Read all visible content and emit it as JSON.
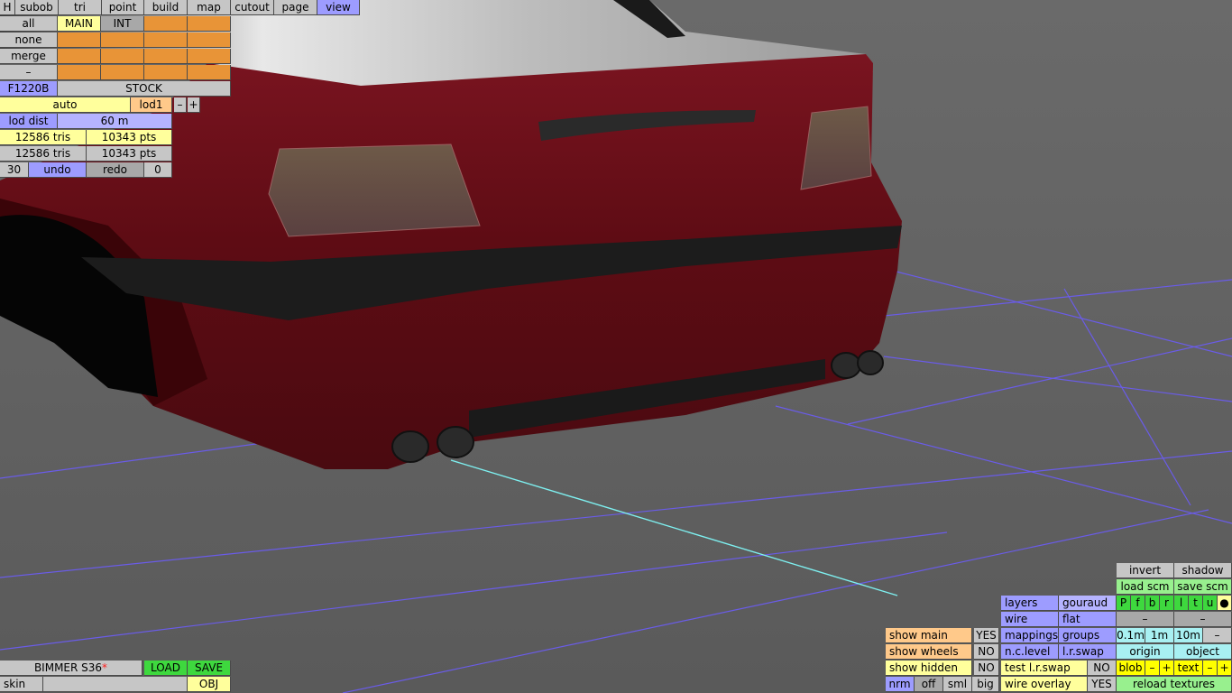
{
  "top_menu": [
    "H",
    "subob",
    "tri",
    "point",
    "build",
    "map",
    "cutout",
    "page",
    "view"
  ],
  "selection": {
    "rows": [
      "all",
      "none",
      "merge",
      "–"
    ],
    "main_label": "MAIN",
    "int_label": "INT"
  },
  "object": {
    "code": "F1220B",
    "variant": "STOCK",
    "lod_mode": "auto",
    "lod_level": "lod1",
    "minus": "–",
    "plus": "+",
    "lod_dist_label": "lod dist",
    "lod_dist_value": "60 m",
    "tris1": "12586 tris",
    "pts1": "10343 pts",
    "tris2": "12586 tris",
    "pts2": "10343 pts",
    "undo_count": "30",
    "undo_label": "undo",
    "redo_label": "redo",
    "redo_count": "0"
  },
  "file": {
    "name": "BIMMER S36",
    "modified_mark": "*",
    "load": "LOAD",
    "save": "SAVE",
    "skin": "skin",
    "obj": "OBJ"
  },
  "view_panel": {
    "invert": "invert",
    "shadow": "shadow",
    "load_scm": "load scm",
    "save_scm": "save scm",
    "layer_flags": [
      "P",
      "f",
      "b",
      "r",
      "l",
      "t",
      "u",
      "●"
    ],
    "dash": "–",
    "layers": "layers",
    "gouraud": "gouraud",
    "wire": "wire",
    "flat": "flat",
    "mappings": "mappings",
    "groups": "groups",
    "n_c_level": "n.c.level",
    "l_r_swap": "l.r.swap",
    "test_l_r_swap": "test l.r.swap",
    "test_l_r_swap_value": "NO",
    "wire_overlay": "wire overlay",
    "wire_overlay_value": "YES",
    "show_main": "show main",
    "show_main_value": "YES",
    "show_wheels": "show wheels",
    "show_wheels_value": "NO",
    "show_hidden": "show hidden",
    "show_hidden_value": "NO",
    "grid_sizes": [
      "0.1m",
      "1m",
      "10m"
    ],
    "origin": "origin",
    "object": "object",
    "blob": "blob",
    "text": "text",
    "minus": "–",
    "plus": "+",
    "normals": [
      "nrm",
      "off",
      "sml",
      "big"
    ],
    "reload_textures": "reload textures"
  }
}
